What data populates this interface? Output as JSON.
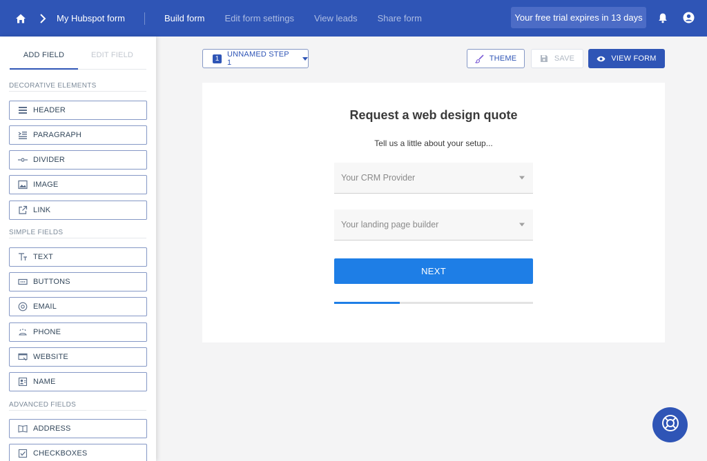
{
  "topbar": {
    "form_name": "My Hubspot form",
    "nav": [
      "Build form",
      "Edit form settings",
      "View leads",
      "Share form"
    ],
    "active_nav": "Build form",
    "trial_text": "Your free trial expires in 13 days"
  },
  "sidebar": {
    "tabs": {
      "add": "ADD FIELD",
      "edit": "EDIT FIELD"
    },
    "sections": {
      "decorative": "DECORATIVE ELEMENTS",
      "simple": "SIMPLE FIELDS",
      "advanced": "ADVANCED FIELDS"
    },
    "decorative_items": [
      {
        "label": "HEADER",
        "icon": "header-icon"
      },
      {
        "label": "PARAGRAPH",
        "icon": "paragraph-icon"
      },
      {
        "label": "DIVIDER",
        "icon": "divider-icon"
      },
      {
        "label": "IMAGE",
        "icon": "image-icon"
      },
      {
        "label": "LINK",
        "icon": "link-icon"
      }
    ],
    "simple_items": [
      {
        "label": "TEXT",
        "icon": "text-icon"
      },
      {
        "label": "BUTTONS",
        "icon": "buttons-icon"
      },
      {
        "label": "EMAIL",
        "icon": "email-icon"
      },
      {
        "label": "PHONE",
        "icon": "phone-icon"
      },
      {
        "label": "WEBSITE",
        "icon": "website-icon"
      },
      {
        "label": "NAME",
        "icon": "name-icon"
      }
    ],
    "advanced_items": [
      {
        "label": "ADDRESS",
        "icon": "address-icon"
      },
      {
        "label": "CHECKBOXES",
        "icon": "checkboxes-icon"
      }
    ]
  },
  "toolbar": {
    "step_number": "1",
    "step_label": "UNNAMED STEP 1",
    "theme_label": "THEME",
    "save_label": "SAVE",
    "view_label": "VIEW FORM"
  },
  "form": {
    "title": "Request a web design quote",
    "subtitle": "Tell us a little about your setup...",
    "crm_placeholder": "Your CRM Provider",
    "builder_placeholder": "Your landing page builder",
    "next_label": "NEXT",
    "progress": 0.33
  },
  "colors": {
    "brand": "#2f55b6",
    "primary_button": "#1e7ee6"
  }
}
